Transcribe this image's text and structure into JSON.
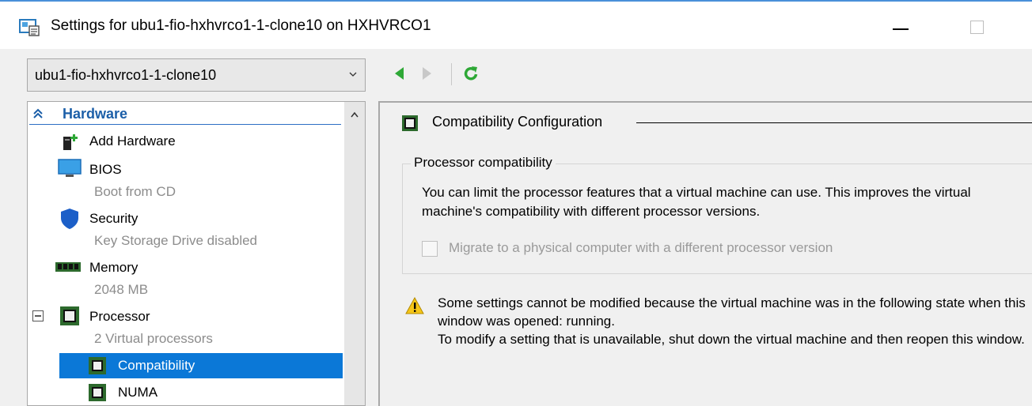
{
  "window": {
    "title": "Settings for ubu1-fio-hxhvrco1-1-clone10 on HXHVRCO1"
  },
  "vm_selector": {
    "selected": "ubu1-fio-hxhvrco1-1-clone10"
  },
  "nav": {
    "back_icon": "back-arrow-icon",
    "forward_icon": "forward-arrow-icon",
    "refresh_icon": "refresh-icon",
    "accent": "#3aa832"
  },
  "tree": {
    "section": "Hardware",
    "items": [
      {
        "label": "Add Hardware",
        "sub": ""
      },
      {
        "label": "BIOS",
        "sub": "Boot from CD"
      },
      {
        "label": "Security",
        "sub": "Key Storage Drive disabled"
      },
      {
        "label": "Memory",
        "sub": "2048 MB"
      },
      {
        "label": "Processor",
        "sub": "2 Virtual processors"
      },
      {
        "label": "Compatibility",
        "sub": ""
      },
      {
        "label": "NUMA",
        "sub": ""
      }
    ],
    "selected_color": "#0b78d7"
  },
  "panel": {
    "title": "Compatibility Configuration",
    "group_title": "Processor compatibility",
    "description": "You can limit the processor features that a virtual machine can use. This improves the virtual machine's compatibility with different processor versions.",
    "checkbox_label": "Migrate to a physical computer with a different processor version",
    "checkbox_checked": false,
    "warning_line1": "Some settings cannot be modified because the virtual machine was in the following state when this window was opened: running.",
    "warning_line2": "To modify a setting that is unavailable, shut down the virtual machine and then reopen this window."
  }
}
